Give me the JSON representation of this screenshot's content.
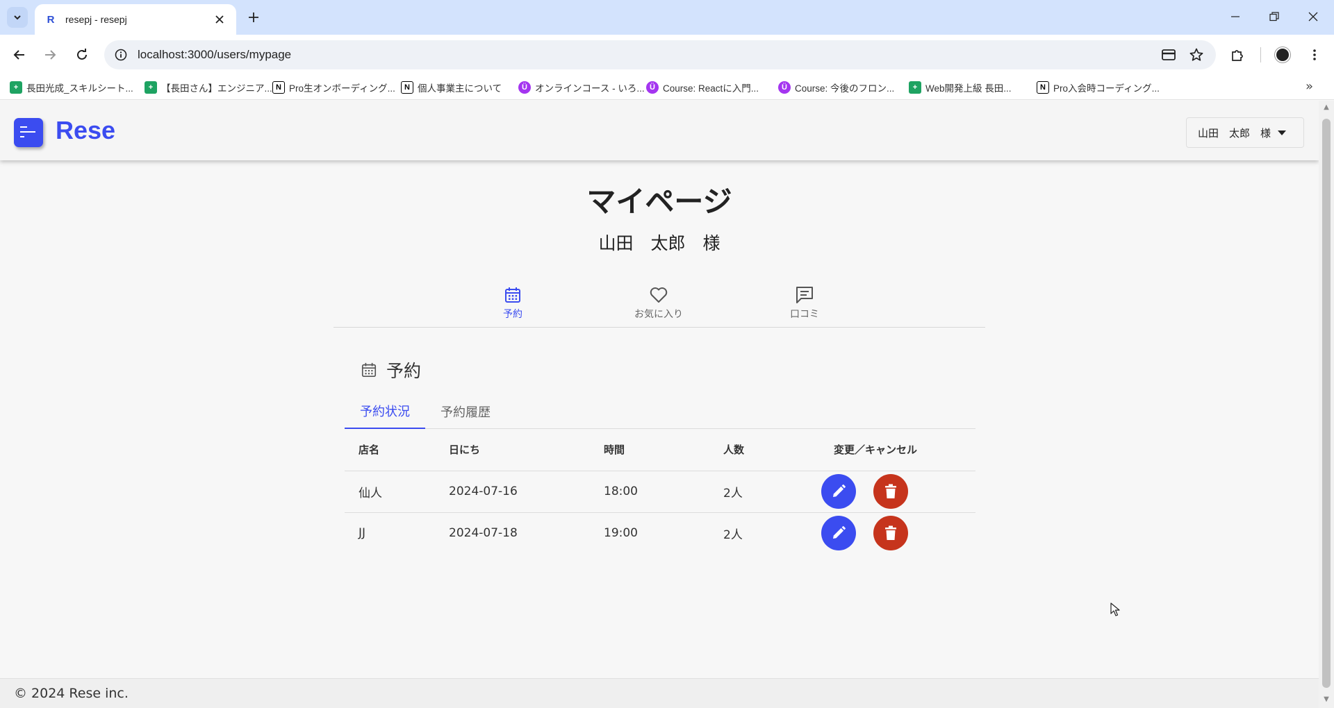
{
  "browser": {
    "tab_title": "resepj - resepj",
    "tab_favicon": "R",
    "url": "localhost:3000/users/mypage",
    "bookmarks": [
      {
        "icon": "sheets-icon",
        "label": "長田光成_スキルシート..."
      },
      {
        "icon": "sheets-icon",
        "label": "【長田さん】エンジニア..."
      },
      {
        "icon": "notion-icon",
        "label": "Pro生オンボーディング..."
      },
      {
        "icon": "notion-icon",
        "label": "個人事業主について"
      },
      {
        "icon": "udemy-icon",
        "label": "オンラインコース - いろ..."
      },
      {
        "icon": "udemy-icon",
        "label": "Course: Reactに入門..."
      },
      {
        "icon": "udemy-icon",
        "label": "Course: 今後のフロン..."
      },
      {
        "icon": "sheets-icon",
        "label": "Web開発上級 長田..."
      },
      {
        "icon": "notion-icon",
        "label": "Pro入会時コーディング..."
      }
    ],
    "bookmarks_more": "»"
  },
  "header": {
    "logo_text": "Rese",
    "user_menu_label": "山田　太郎　様"
  },
  "page": {
    "title": "マイページ",
    "user_name": "山田　太郎　様"
  },
  "main_tabs": [
    {
      "label": "予約",
      "icon": "calendar-icon",
      "active": true
    },
    {
      "label": "お気に入り",
      "icon": "heart-icon",
      "active": false
    },
    {
      "label": "口コミ",
      "icon": "comment-icon",
      "active": false
    }
  ],
  "section": {
    "title": "予約",
    "icon": "calendar-icon"
  },
  "sub_tabs": [
    {
      "label": "予約状況",
      "active": true
    },
    {
      "label": "予約履歴",
      "active": false
    }
  ],
  "table": {
    "headers": [
      "店名",
      "日にち",
      "時間",
      "人数",
      "変更／キャンセル"
    ],
    "rows": [
      {
        "shop": "仙人",
        "date": "2024-07-16",
        "time": "18:00",
        "people": "2人"
      },
      {
        "shop": "JJ",
        "date": "2024-07-18",
        "time": "19:00",
        "people": "2人"
      }
    ]
  },
  "footer": {
    "copyright": "© 2024 Rese inc."
  },
  "colors": {
    "accent": "#3b4cf0",
    "danger": "#c6341c"
  }
}
